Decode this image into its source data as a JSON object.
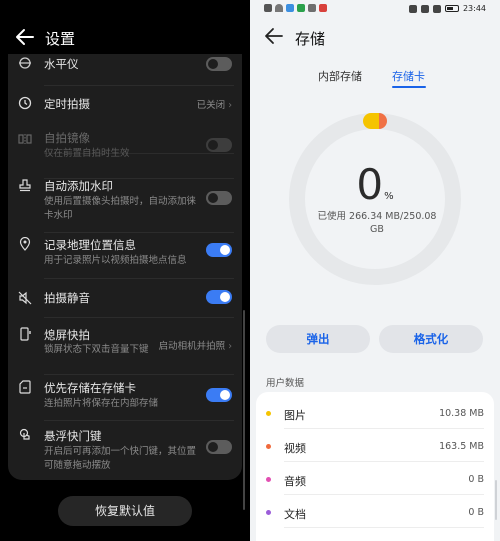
{
  "left": {
    "title": "设置",
    "rows": [
      {
        "title": "水平仪",
        "toggle": "off"
      },
      {
        "title": "定时拍摄",
        "value": "已关闭"
      },
      {
        "title": "自拍镜像",
        "subtitle": "仅在前置自拍时生效",
        "toggle": "off",
        "disabled": true
      },
      {
        "title": "自动添加水印",
        "subtitle": "使用后置摄像头拍摄时，自动添加徕卡水印",
        "toggle": "off"
      },
      {
        "title": "记录地理位置信息",
        "subtitle": "用于记录照片以视频拍摄地点信息",
        "toggle": "on"
      },
      {
        "title": "拍摄静音",
        "toggle": "on"
      },
      {
        "title": "熄屏快拍",
        "subtitle": "锁屏状态下双击音量下键",
        "value": "启动相机并拍照"
      },
      {
        "title": "优先存储在存储卡",
        "subtitle": "连拍照片将保存在内部存储",
        "toggle": "on"
      },
      {
        "title": "悬浮快门键",
        "subtitle": "开启后可再添加一个快门键，其位置可随意拖动摆放",
        "toggle": "off"
      }
    ],
    "reset_label": "恢复默认值"
  },
  "right": {
    "status_time": "23:44",
    "title": "存储",
    "tabs": [
      "内部存储",
      "存储卡"
    ],
    "active_tab": 1,
    "percent": "0",
    "percent_unit": "%",
    "used_text": "已使用 266.34 MB/250.08 GB",
    "used_fraction": 0.001,
    "eject_label": "弹出",
    "format_label": "格式化",
    "section_label": "用户数据",
    "items": [
      {
        "name": "图片",
        "size": "10.38 MB",
        "color": "#f5c400"
      },
      {
        "name": "视频",
        "size": "163.5 MB",
        "color": "#f06a3c"
      },
      {
        "name": "音频",
        "size": "0 B",
        "color": "#e24fb2"
      },
      {
        "name": "文档",
        "size": "0 B",
        "color": "#9b5cd9"
      }
    ],
    "colors": {
      "accent": "#1a63e8",
      "ring": "#e6e8ea"
    }
  }
}
